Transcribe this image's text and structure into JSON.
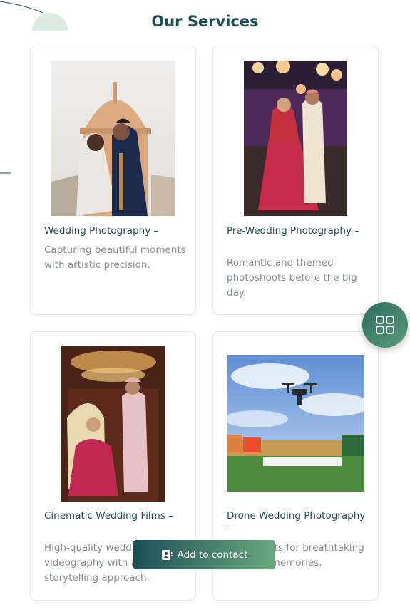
{
  "section": {
    "title": "Our Services"
  },
  "cards": [
    {
      "heading": "Wedding Photography –",
      "description": "Capturing beautiful moments with artistic precision.",
      "image_subject": "couple-palace-dome"
    },
    {
      "heading": "Pre-Wedding Photography –",
      "description": "Romantic and themed photoshoots before the big day.",
      "image_subject": "couple-lights"
    },
    {
      "heading": "Cinematic Wedding Films –",
      "description": "High-quality wedding videography with a storytelling approach.",
      "image_subject": "couple-chandelier"
    },
    {
      "heading": "Drone Wedding Photography –",
      "description": "Aerial shots for breathtaking wedding memories.",
      "image_subject": "drone-venue"
    }
  ],
  "fab": {
    "icon": "grid-icon"
  },
  "contact_button": {
    "label": "Add to contact",
    "icon": "contact-card-icon"
  },
  "colors": {
    "brand_dark": "#1d4e57",
    "brand_light": "#6aa87c",
    "text_muted": "#858d92"
  }
}
